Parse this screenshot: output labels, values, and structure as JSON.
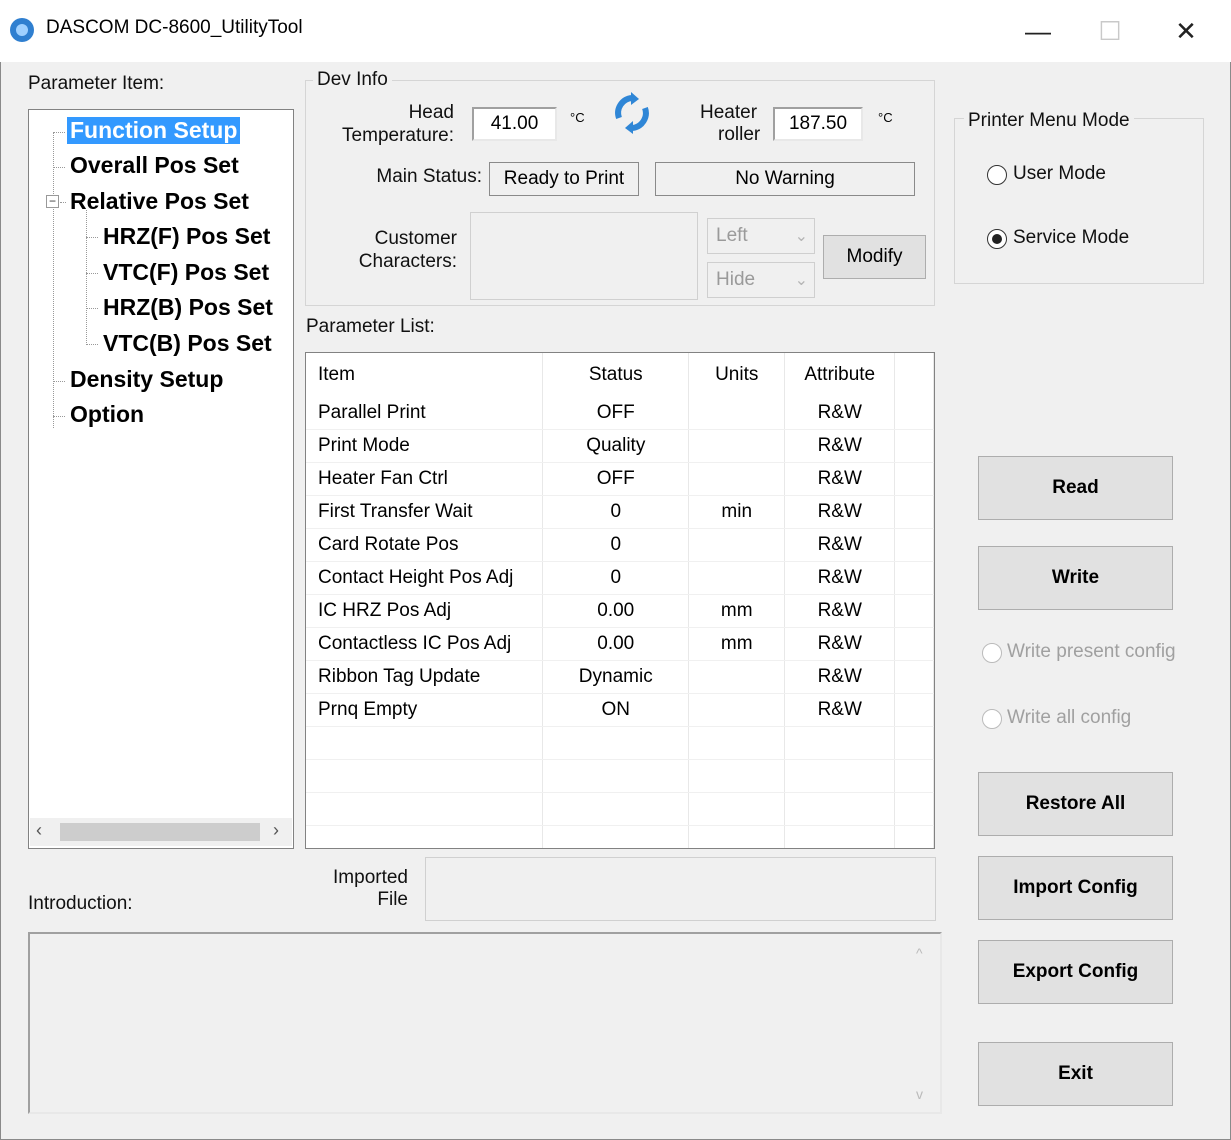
{
  "window": {
    "title": "DASCOM DC-8600_UtilityTool",
    "minimize": "—",
    "maximize": "☐",
    "close": "✕"
  },
  "tree": {
    "label": "Parameter Item:",
    "nodes": [
      {
        "label": "Function Setup"
      },
      {
        "label": "Overall Pos Set"
      },
      {
        "label": "Relative Pos Set"
      },
      {
        "label": "HRZ(F) Pos Set"
      },
      {
        "label": "VTC(F) Pos Set"
      },
      {
        "label": "HRZ(B) Pos Set"
      },
      {
        "label": "VTC(B) Pos Set"
      },
      {
        "label": "Density Setup"
      },
      {
        "label": "Option"
      }
    ]
  },
  "dev_info": {
    "group_label": "Dev Info",
    "head_temp_label_1": "Head",
    "head_temp_label_2": "Temperature:",
    "head_temp_value": "41.00",
    "head_temp_unit": "°C",
    "heater_label_1": "Heater",
    "heater_label_2": "roller",
    "heater_value": "187.50",
    "heater_unit": "°C",
    "main_status_label": "Main Status:",
    "main_status_value": "Ready to Print",
    "warning_value": "No Warning",
    "customer_label_1": "Customer",
    "customer_label_2": "Characters:",
    "align_value": "Left",
    "visibility_value": "Hide",
    "modify_label": "Modify"
  },
  "parameter_list": {
    "label": "Parameter List:",
    "columns": [
      "Item",
      "Status",
      "Units",
      "Attribute"
    ],
    "rows": [
      [
        "Parallel Print",
        "OFF",
        "",
        "R&W"
      ],
      [
        "Print Mode",
        "Quality",
        "",
        "R&W"
      ],
      [
        "Heater Fan Ctrl",
        "OFF",
        "",
        "R&W"
      ],
      [
        "First Transfer Wait",
        "0",
        "min",
        "R&W"
      ],
      [
        "Card Rotate Pos",
        "0",
        "",
        "R&W"
      ],
      [
        "Contact Height Pos Adj",
        "0",
        "",
        "R&W"
      ],
      [
        "IC HRZ Pos Adj",
        "0.00",
        "mm",
        "R&W"
      ],
      [
        "Contactless IC Pos Adj",
        "0.00",
        "mm",
        "R&W"
      ],
      [
        "Ribbon Tag Update",
        "Dynamic",
        "",
        "R&W"
      ],
      [
        "Prnq Empty",
        "ON",
        "",
        "R&W"
      ]
    ]
  },
  "imported": {
    "label_1": "Imported",
    "label_2": "File",
    "value": ""
  },
  "introduction": {
    "label": "Introduction:",
    "text": ""
  },
  "printer_menu_mode": {
    "group_label": "Printer Menu Mode",
    "options": [
      {
        "label": "User Mode",
        "selected": false
      },
      {
        "label": "Service Mode",
        "selected": true
      }
    ]
  },
  "actions": {
    "read": "Read",
    "write": "Write",
    "write_present": "Write present config",
    "write_all": "Write all config",
    "restore_all": "Restore All",
    "import_config": "Import Config",
    "export_config": "Export Config",
    "exit": "Exit"
  },
  "colors": {
    "selection": "#3399ff",
    "refresh_icon": "#2f86d6",
    "window_bg": "#f0f0f0"
  }
}
